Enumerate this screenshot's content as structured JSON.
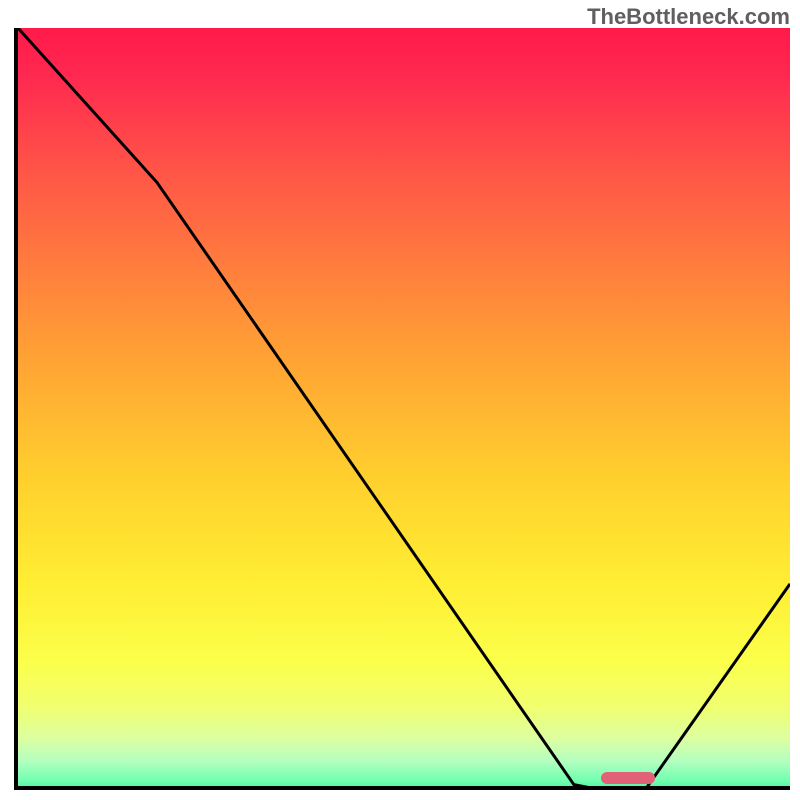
{
  "watermark": "TheBottleneck.com",
  "chart_data": {
    "type": "line",
    "title": "",
    "xlabel": "",
    "ylabel": "",
    "xlim": [
      0,
      100
    ],
    "ylim": [
      0,
      100
    ],
    "grid": false,
    "series": [
      {
        "name": "curve",
        "color": "#000000",
        "x": [
          0,
          18,
          72,
          77,
          81,
          100
        ],
        "y": [
          100,
          80,
          2,
          1,
          1,
          28
        ]
      }
    ],
    "marker": {
      "x_center": 79,
      "width_pct": 7,
      "y": 1,
      "color": "#e16277"
    },
    "background_gradient": {
      "stops": [
        {
          "pos": 0.0,
          "color": "#ff1a4a"
        },
        {
          "pos": 0.06,
          "color": "#ff2850"
        },
        {
          "pos": 0.2,
          "color": "#ff5a46"
        },
        {
          "pos": 0.4,
          "color": "#ff9a36"
        },
        {
          "pos": 0.58,
          "color": "#ffcf2d"
        },
        {
          "pos": 0.72,
          "color": "#ffee33"
        },
        {
          "pos": 0.82,
          "color": "#fbff4a"
        },
        {
          "pos": 0.88,
          "color": "#f1ff70"
        },
        {
          "pos": 0.92,
          "color": "#dcffa0"
        },
        {
          "pos": 0.95,
          "color": "#b3ffc0"
        },
        {
          "pos": 0.975,
          "color": "#70ffb0"
        },
        {
          "pos": 1.0,
          "color": "#28e090"
        }
      ]
    }
  }
}
